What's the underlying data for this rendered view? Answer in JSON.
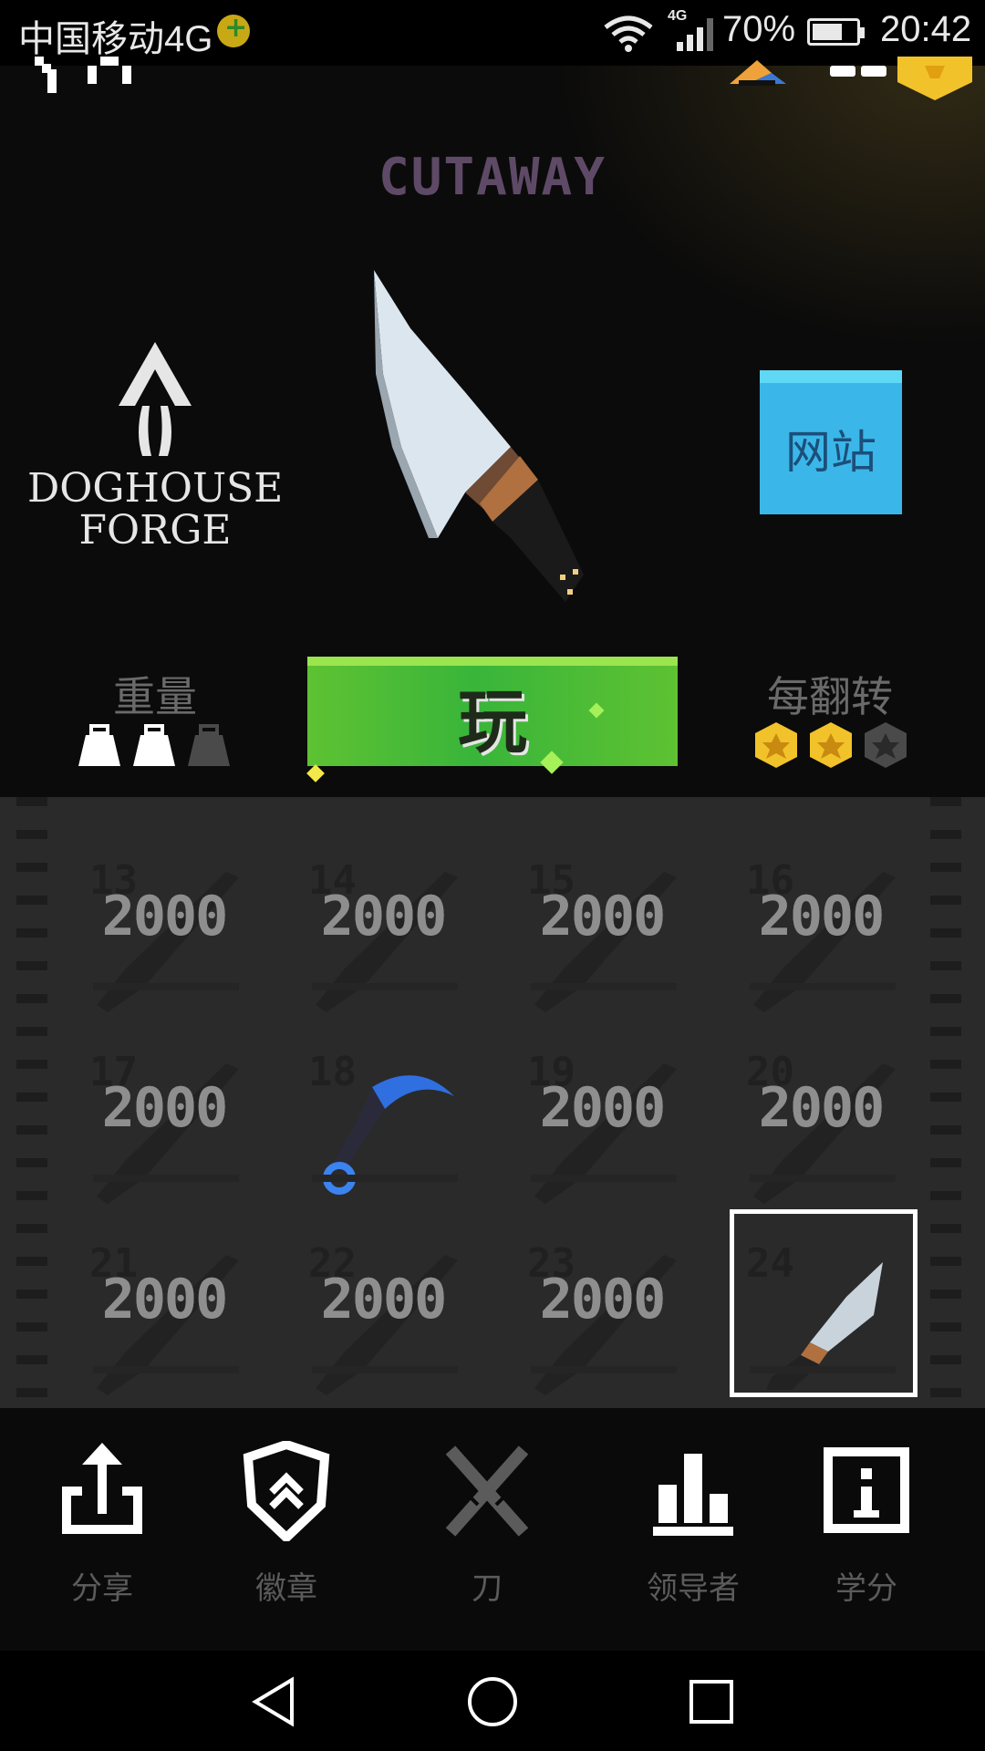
{
  "status_bar": {
    "carrier": "中国移动4G",
    "network_badge": "4G",
    "battery_percent": "70%",
    "battery_level": 0.7,
    "time": "20:42"
  },
  "knife": {
    "name": "CUTAWAY",
    "maker_line1": "DOGHOUSE",
    "maker_line2": "FORGE",
    "website_label": "网站",
    "play_label": "玩",
    "weight_label": "重量",
    "weight_rating": 2,
    "weight_max": 3,
    "flip_label": "每翻转",
    "flip_rating": 2,
    "flip_max": 3
  },
  "grid": {
    "cells": [
      {
        "number": "13",
        "price": "2000",
        "locked": true
      },
      {
        "number": "14",
        "price": "2000",
        "locked": true
      },
      {
        "number": "15",
        "price": "2000",
        "locked": true
      },
      {
        "number": "16",
        "price": "2000",
        "locked": true
      },
      {
        "number": "17",
        "price": "2000",
        "locked": true
      },
      {
        "number": "18",
        "price": "",
        "locked": false
      },
      {
        "number": "19",
        "price": "2000",
        "locked": true
      },
      {
        "number": "20",
        "price": "2000",
        "locked": true
      },
      {
        "number": "21",
        "price": "2000",
        "locked": true
      },
      {
        "number": "22",
        "price": "2000",
        "locked": true
      },
      {
        "number": "23",
        "price": "2000",
        "locked": true
      },
      {
        "number": "24",
        "price": "",
        "locked": false,
        "selected": true
      }
    ]
  },
  "bottom_nav": {
    "items": [
      {
        "label": "分享",
        "icon": "share-icon"
      },
      {
        "label": "徽章",
        "icon": "badge-shield-icon"
      },
      {
        "label": "刀",
        "icon": "crossed-knives-icon"
      },
      {
        "label": "领导者",
        "icon": "leaderboard-icon"
      },
      {
        "label": "学分",
        "icon": "info-icon"
      }
    ]
  },
  "colors": {
    "play_green": "#39b53a",
    "website_blue": "#3bb6e8",
    "badge_gold": "#f2c22a",
    "title_purple": "#5e4a66"
  }
}
